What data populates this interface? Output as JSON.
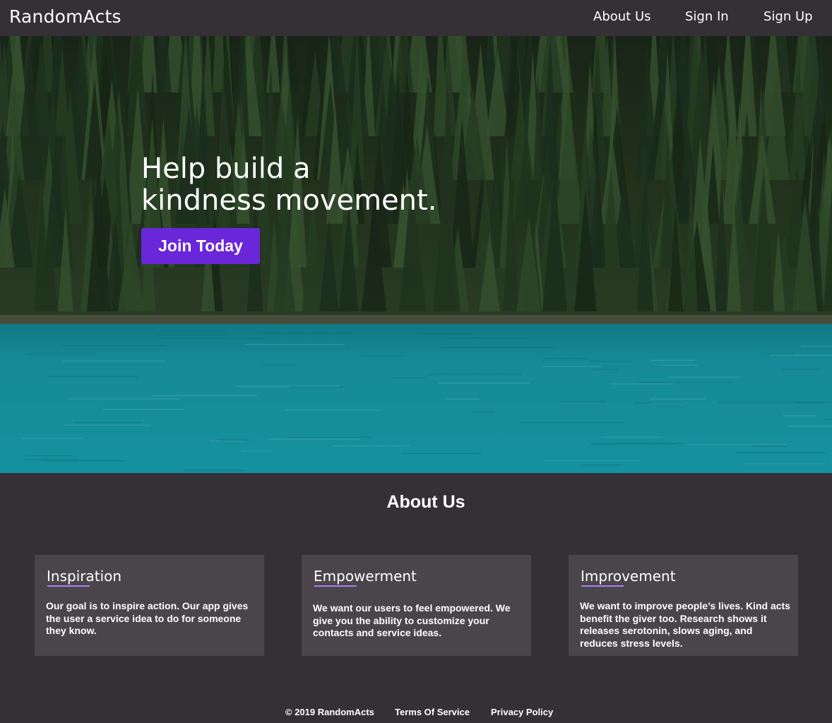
{
  "header": {
    "brand": "RandomActs",
    "nav": [
      "About Us",
      "Sign In",
      "Sign Up"
    ]
  },
  "hero": {
    "title_line1": "Help build a",
    "title_line2": "kindness movement.",
    "cta_label": "Join Today"
  },
  "about": {
    "title": "About Us",
    "cards": [
      {
        "title": "Inspiration",
        "body": "Our goal is to inspire action.  Our app gives the user a service idea to do for someone they know."
      },
      {
        "title": "Empowerment",
        "body": "We want our users to feel empowered. We give you the ability to customize your contacts and service ideas."
      },
      {
        "title": "Improvement",
        "body": "We want to improve people’s lives.  Kind acts benefit the giver too.  Research shows it releases serotonin, slows aging, and reduces stress levels."
      }
    ]
  },
  "footer": {
    "copyright": "© 2019 RandomActs",
    "terms": "Terms Of Service",
    "privacy": "Privacy Policy"
  },
  "colors": {
    "background": "#353036",
    "card": "#4a454b",
    "accent": "#6a26d9",
    "underline": "#a97ff0",
    "water": "#1aa3b3"
  }
}
